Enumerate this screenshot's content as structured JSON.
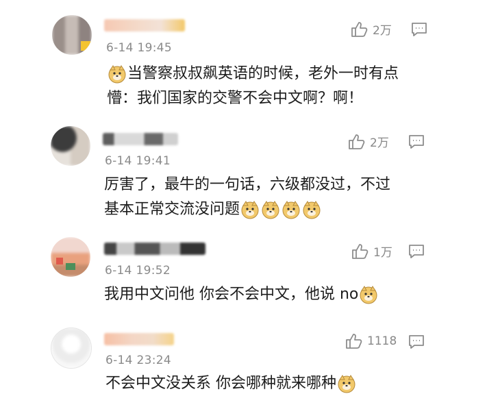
{
  "comments": [
    {
      "time": "6-14 19:45",
      "likes": "2万",
      "text_line1": "当警察叔叔飙英语的时候，老外一时有点",
      "text_line2": "懵：我们国家的交警不会中文啊？啊！"
    },
    {
      "time": "6-14 19:41",
      "likes": "2万",
      "text_line1": "厉害了，最牛的一句话，六级都没过，不过",
      "text_line2": "基本正常交流没问题"
    },
    {
      "time": "6-14 19:52",
      "likes": "1万",
      "text_line1": "我用中文问他 你会不会中文，他说 no"
    },
    {
      "time": "6-14 23:24",
      "likes": "1118",
      "text_line1": "不会中文没关系 你会哪种就来哪种"
    }
  ],
  "colors": {
    "text": "#1c1c1c",
    "meta": "#8a8a8a",
    "icon": "#8c8c8c"
  },
  "icons": {
    "like": "thumbs-up-icon",
    "reply": "comment-bubble-icon",
    "emoji": "doge-emoji-icon"
  }
}
